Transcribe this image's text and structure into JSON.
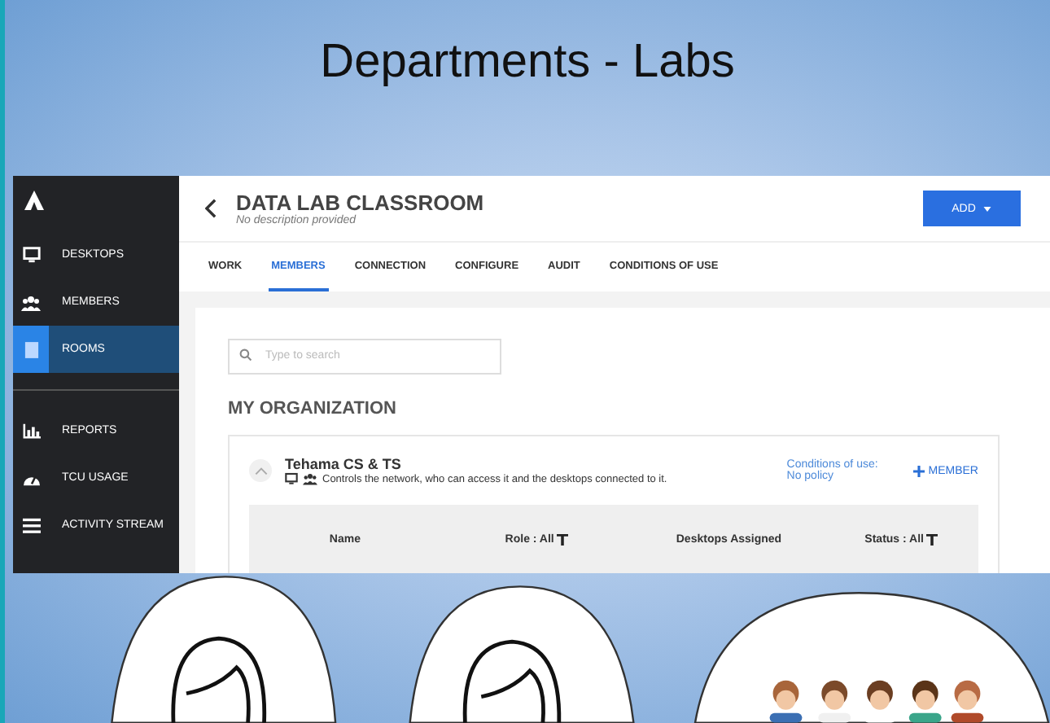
{
  "slide": {
    "title": "Departments - Labs"
  },
  "sidebar": {
    "sections": [
      [
        {
          "label": "DESKTOPS",
          "selected": false
        },
        {
          "label": "MEMBERS",
          "selected": false
        },
        {
          "label": "ROOMS",
          "selected": true
        }
      ],
      [
        {
          "label": "REPORTS",
          "selected": false
        },
        {
          "label": "TCU USAGE",
          "selected": false
        },
        {
          "label": "ACTIVITY STREAM",
          "selected": false
        }
      ]
    ]
  },
  "header": {
    "title": "DATA LAB CLASSROOM",
    "subtitle": "No description provided",
    "add_button": "ADD"
  },
  "tabs": [
    {
      "label": "WORK",
      "selected": false
    },
    {
      "label": "MEMBERS",
      "selected": true
    },
    {
      "label": "CONNECTION",
      "selected": false
    },
    {
      "label": "CONFIGURE",
      "selected": false
    },
    {
      "label": "AUDIT",
      "selected": false
    },
    {
      "label": "CONDITIONS OF USE",
      "selected": false
    }
  ],
  "search": {
    "placeholder": "Type to search"
  },
  "section_title": "MY ORGANIZATION",
  "organization": {
    "name": "Tehama CS & TS",
    "expanded": true,
    "description": "Controls the network, who can access it and the desktops connected to it.",
    "conditions_link": "Conditions of use: No policy",
    "member_button": "MEMBER"
  },
  "table": {
    "columns": [
      {
        "label": "Name",
        "filter": false
      },
      {
        "label": "Role : All",
        "filter": true
      },
      {
        "label": "Desktops Assigned",
        "filter": false
      },
      {
        "label": "Status : All",
        "filter": true
      }
    ]
  }
}
